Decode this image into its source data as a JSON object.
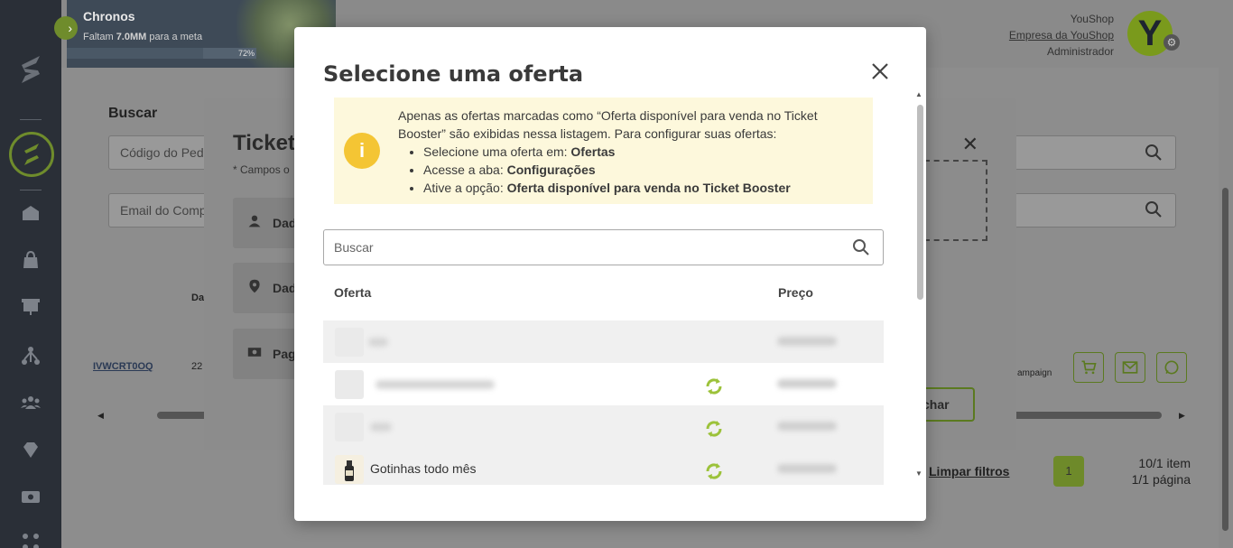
{
  "banner": {
    "title": "Chronos",
    "subtitle_prefix": "Faltam ",
    "subtitle_amount": "7.0MM",
    "subtitle_suffix": " para a meta",
    "progress_label": "72%",
    "progress_value": 0.72
  },
  "user": {
    "shop": "YouShop",
    "company_link": "Empresa da YouShop",
    "role": "Administrador",
    "avatar_letter": "Y"
  },
  "sidebar": {
    "icons": [
      "logo-icon",
      "dashboard-icon",
      "bag-icon",
      "presentation-icon",
      "network-icon",
      "users-icon",
      "diamond-icon",
      "cash-icon",
      "apps-icon"
    ]
  },
  "background": {
    "search_label": "Buscar",
    "order_code_placeholder": "Código do Pedi",
    "email_placeholder": "Email do Comp",
    "table_header": "Da",
    "order_link": "IVWCRT0OQ",
    "order_num": "22",
    "campaign_text": "ampaign",
    "clear_filters": "Limpar filtros",
    "page_current": "1",
    "items_text": "10/1 item",
    "pages_text": "1/1 página"
  },
  "ticket_modal": {
    "title": "Ticket",
    "subtitle": "* Campos o",
    "cards": [
      "Dad",
      "Dad",
      "Pag"
    ],
    "close_button": "Fechar",
    "close_button_visible": "char"
  },
  "offer_modal": {
    "title": "Selecione uma oferta",
    "notice": {
      "line1": "Apenas as ofertas marcadas como “Oferta disponível para venda no Ticket Booster” são exibidas nessa listagem. Para configurar suas ofertas:",
      "items": [
        {
          "text": "Selecione uma oferta em: ",
          "bold": "Ofertas"
        },
        {
          "text": "Acesse a aba: ",
          "bold": "Configurações"
        },
        {
          "text": "Ative a opção: ",
          "bold": "Oferta disponível para venda no Ticket Booster"
        }
      ]
    },
    "search_placeholder": "Buscar",
    "columns": {
      "offer": "Oferta",
      "price": "Preço"
    },
    "rows": [
      {
        "name": "",
        "synced": false
      },
      {
        "name": "",
        "synced": true
      },
      {
        "name": "",
        "synced": true
      },
      {
        "name": "Gotinhas todo mês",
        "synced": true
      }
    ]
  },
  "colors": {
    "accent": "#7a9a1c",
    "notice_bg": "#fdf8dc",
    "warning": "#f4c534",
    "sidebar": "#2a2f37"
  }
}
